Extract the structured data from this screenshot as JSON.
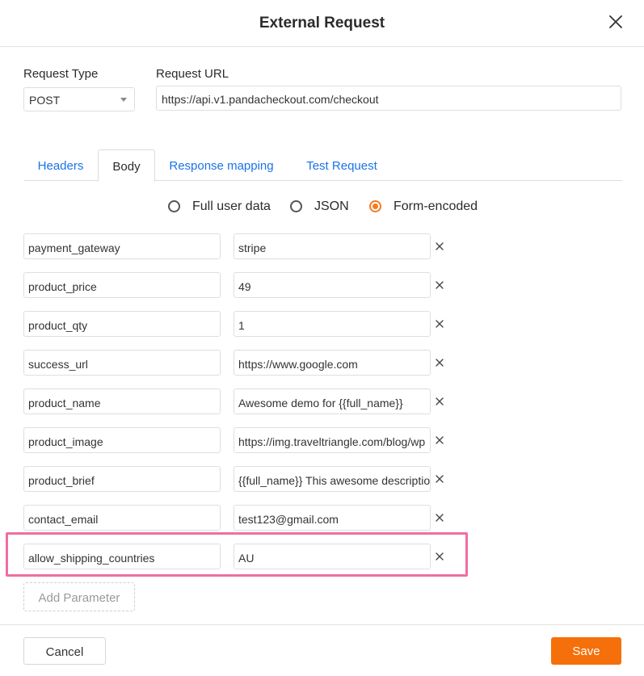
{
  "dialog": {
    "title": "External Request"
  },
  "request": {
    "type_label": "Request Type",
    "type_value": "POST",
    "url_label": "Request URL",
    "url_value": "https://api.v1.pandacheckout.com/checkout"
  },
  "tabs": [
    {
      "label": "Headers",
      "active": false
    },
    {
      "label": "Body",
      "active": true
    },
    {
      "label": "Response mapping",
      "active": false
    },
    {
      "label": "Test Request",
      "active": false
    }
  ],
  "body_format": {
    "options": [
      {
        "label": "Full user data",
        "checked": false
      },
      {
        "label": "JSON",
        "checked": false
      },
      {
        "label": "Form-encoded",
        "checked": true
      }
    ]
  },
  "params": [
    {
      "key": "payment_gateway",
      "value": "stripe"
    },
    {
      "key": "product_price",
      "value": "49"
    },
    {
      "key": "product_qty",
      "value": "1"
    },
    {
      "key": "success_url",
      "value": "https://www.google.com"
    },
    {
      "key": "product_name",
      "value": "Awesome demo for {{full_name}}"
    },
    {
      "key": "product_image",
      "value": "https://img.traveltriangle.com/blog/wp"
    },
    {
      "key": "product_brief",
      "value": "{{full_name}} This awesome descriptio"
    },
    {
      "key": "contact_email",
      "value": "test123@gmail.com"
    },
    {
      "key": "allow_shipping_countries",
      "value": "AU",
      "highlighted": true
    }
  ],
  "add_param_label": "Add Parameter",
  "footer": {
    "cancel_label": "Cancel",
    "save_label": "Save"
  },
  "colors": {
    "accent": "#f5700a",
    "link": "#1a73e8",
    "highlight": "#ef6ea1"
  },
  "icons": {
    "close": "close-icon",
    "remove": "close-icon",
    "caret": "chevron-down-icon"
  }
}
